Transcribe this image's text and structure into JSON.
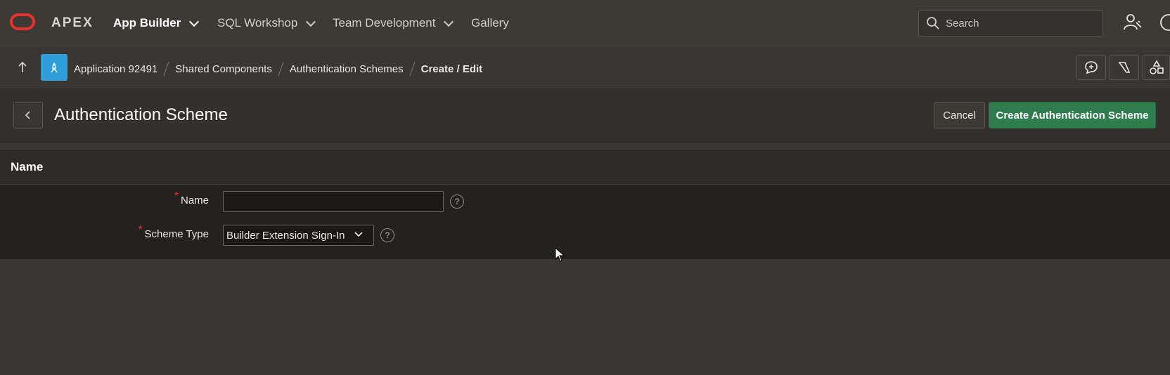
{
  "topbar": {
    "logo_text": "APEX",
    "nav": [
      {
        "label": "App Builder",
        "has_menu": true,
        "active": true
      },
      {
        "label": "SQL Workshop",
        "has_menu": true,
        "active": false
      },
      {
        "label": "Team Development",
        "has_menu": true,
        "active": false
      },
      {
        "label": "Gallery",
        "has_menu": false,
        "active": false
      }
    ],
    "search_placeholder": "Search"
  },
  "breadcrumb": {
    "items": [
      "Application 92491",
      "Shared Components",
      "Authentication Schemes",
      "Create / Edit"
    ]
  },
  "page": {
    "title": "Authentication Scheme",
    "cancel_label": "Cancel",
    "create_label": "Create Authentication Scheme"
  },
  "region": {
    "title": "Name",
    "fields": {
      "name": {
        "label": "Name",
        "value": "",
        "required": true
      },
      "scheme_type": {
        "label": "Scheme Type",
        "value": "Builder Extension Sign-In",
        "required": true
      }
    }
  },
  "colors": {
    "accent_green": "#2f7d4d",
    "required_red": "#e5322d",
    "app_badge_blue": "#2e9fdb"
  }
}
